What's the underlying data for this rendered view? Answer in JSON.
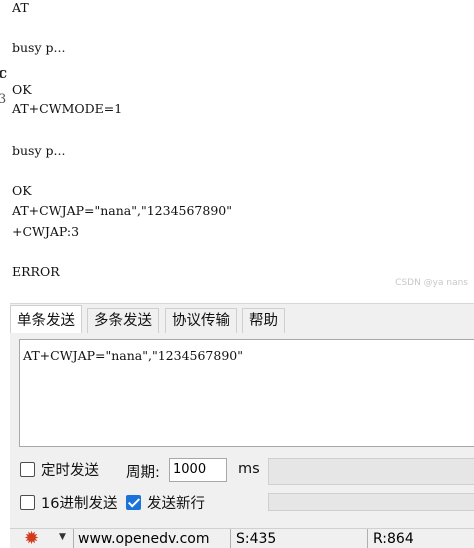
{
  "left_edge": {
    "glyph1": "c",
    "glyph2": "3"
  },
  "receive": {
    "lines": [
      "AT",
      "",
      "busy p...",
      "",
      "OK",
      "AT+CWMODE=1",
      "",
      "busy p...",
      "",
      "OK",
      "AT+CWJAP=\"nana\",\"1234567890\"",
      "+CWJAP:3",
      "",
      "ERROR"
    ],
    "watermark": "CSDN @ya nans"
  },
  "tabs": [
    {
      "label": "单条发送",
      "active": true
    },
    {
      "label": "多条发送",
      "active": false
    },
    {
      "label": "协议传输",
      "active": false
    },
    {
      "label": "帮助",
      "active": false
    }
  ],
  "send": {
    "input_value": "AT+CWJAP=\"nana\",\"1234567890\"",
    "timed_send_label": "定时发送",
    "timed_send_checked": false,
    "period_label": "周期:",
    "period_value": "1000",
    "period_unit": "ms",
    "hex_send_label": "16进制发送",
    "hex_send_checked": false,
    "newline_label": "发送新行",
    "newline_checked": true
  },
  "status": {
    "website": "www.openedv.com",
    "sent": "S:435",
    "received": "R:864"
  },
  "colors": {
    "accent": "#1a73d9",
    "gear": "#d33a1c"
  }
}
